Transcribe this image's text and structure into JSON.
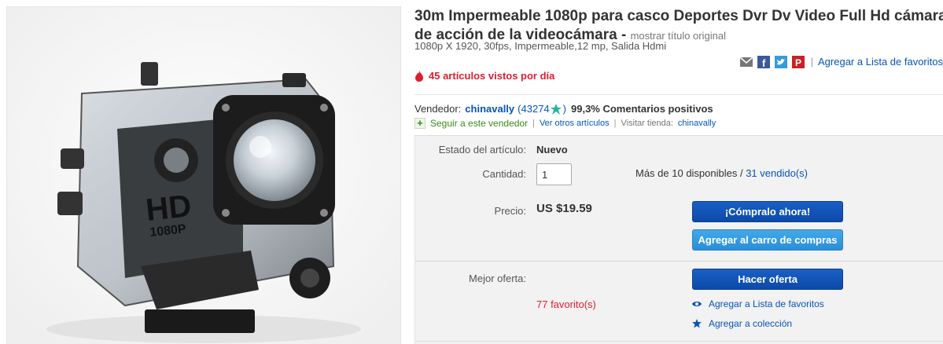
{
  "listing": {
    "title": "30m Impermeable 1080p para casco Deportes Dvr Dv Video Full Hd cámara de acción de la videocámara -",
    "original_title_link": "mostrar título original",
    "subtitle": "1080p X 1920, 30fps, Impermeable,12 mp, Salida Hdmi",
    "views": "45 artículos vistos por día"
  },
  "share": {
    "icons": [
      "email-icon",
      "facebook-icon",
      "twitter-icon",
      "pinterest-icon"
    ],
    "separator": "|",
    "watchlist_link": "Agregar a Lista de favoritos"
  },
  "seller": {
    "label": "Vendedor:",
    "name": "chinavally",
    "score_open": "(",
    "score": "43274",
    "score_close": ")",
    "positive": "99,3% Comentarios positivos",
    "follow": "Seguir a este vendedor",
    "sep": "|",
    "other_items": "Ver otros artículos",
    "store_label": "Visitar tienda:",
    "store_name": "chinavally"
  },
  "buybox": {
    "condition_label": "Estado del artículo:",
    "condition_value": "Nuevo",
    "quantity_label": "Cantidad:",
    "quantity_value": "1",
    "available": "Más de 10 disponibles",
    "available_sep": " / ",
    "sold": "31 vendido(s)",
    "price_label": "Precio:",
    "price_value": "US $19.59",
    "buy_now": "¡Cómpralo ahora!",
    "add_to_cart": "Agregar al carro de compras",
    "best_offer_label": "Mejor oferta:",
    "make_offer": "Hacer oferta",
    "favorites_count": "77 favorito(s)",
    "add_watchlist": "Agregar a Lista de favoritos",
    "add_collection": "Agregar a colección"
  },
  "image": {
    "product_label_1": "HD",
    "product_label_2": "1080P"
  },
  "colors": {
    "link": "#0654ba",
    "alert": "#dd1e31",
    "button_primary": "#0c4aa8",
    "button_secondary": "#2a8fd8"
  }
}
